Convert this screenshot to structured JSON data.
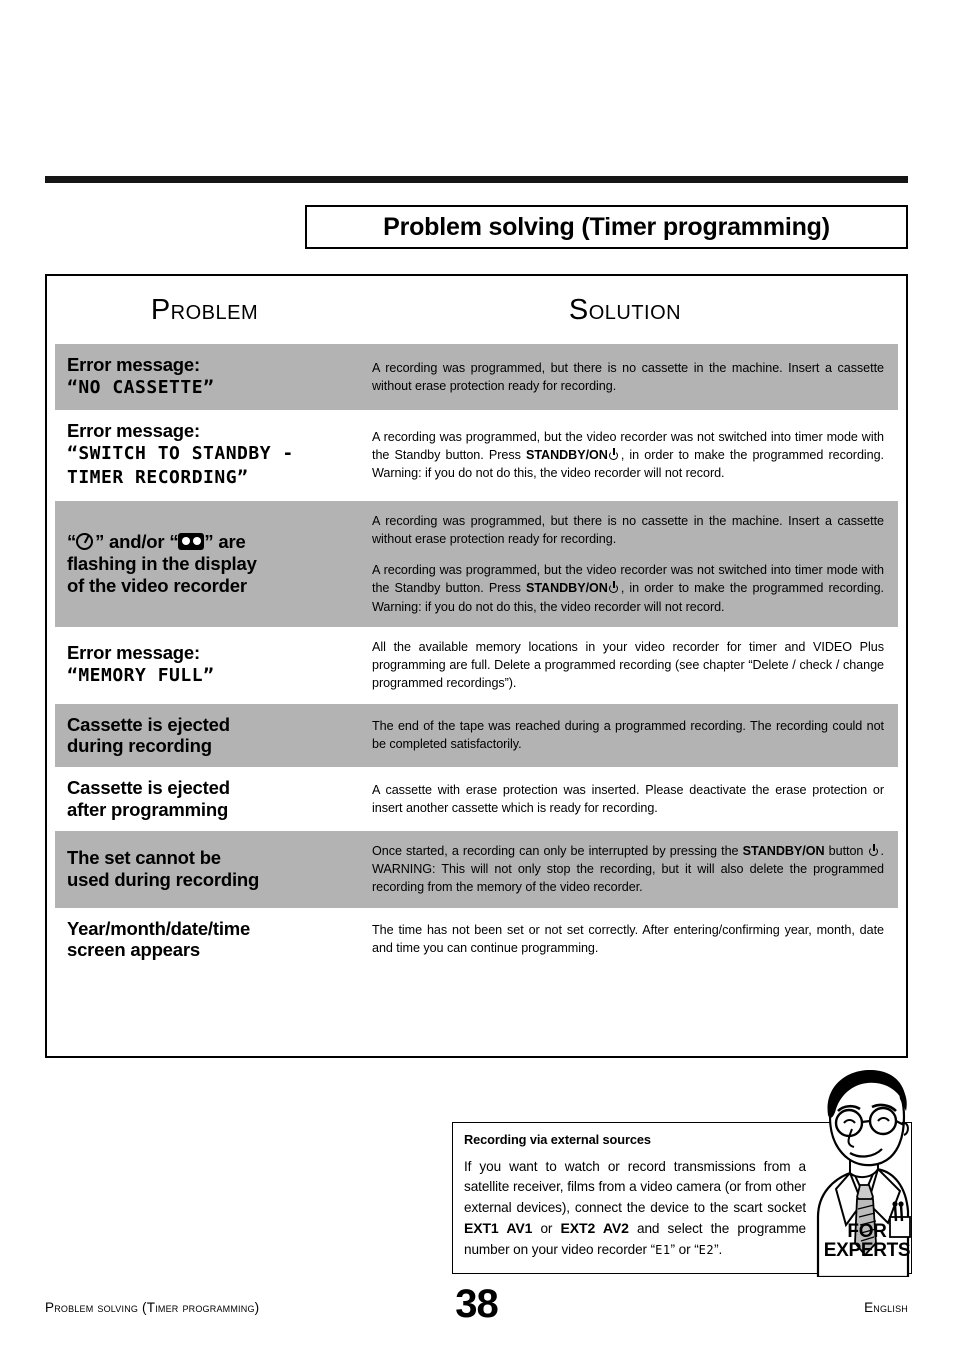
{
  "page": {
    "title": "Problem solving (Timer programming)",
    "number": "38",
    "footer_left": "Problem solving (Timer programming)",
    "footer_right": "English"
  },
  "table": {
    "header": {
      "problem": "Problem",
      "solution": "Solution"
    },
    "rows": [
      {
        "shaded": true,
        "problem_lines": [
          "Error message:"
        ],
        "problem_lcd": [
          "“NO CASSETTE”"
        ],
        "solutions": [
          "A recording was programmed, but there is no cassette in the machine. Insert a cassette without erase protection ready for recording."
        ]
      },
      {
        "shaded": false,
        "problem_lines": [
          "Error message:"
        ],
        "problem_lcd": [
          "“SWITCH TO STANDBY -",
          "TIMER RECORDING”"
        ],
        "solutions": [
          "A recording was programmed, but the video recorder was not switched into timer mode with the Standby button. Press STANDBY/ON ⏻, in order to make the programmed recording. Warning: if you do not do this, the video recorder will not record."
        ]
      },
      {
        "shaded": true,
        "problem_icons": [
          "clock-icon",
          "cassette-icon"
        ],
        "problem_lines": [
          "“ ” and/or “ ” are",
          "flashing in the display",
          "of the video recorder"
        ],
        "solutions": [
          "A recording was programmed, but there is no cassette in the machine. Insert a cassette without erase protection ready for recording.",
          "A recording was programmed, but the video recorder was not switched into timer mode with the Standby button. Press STANDBY/ON ⏻, in order to make the programmed recording. Warning: if you do not do this, the video recorder will not record."
        ]
      },
      {
        "shaded": false,
        "problem_lines": [
          "Error message:"
        ],
        "problem_lcd": [
          "“MEMORY FULL”"
        ],
        "solutions": [
          "All the available memory locations in your video recorder for timer and VIDEO Plus programming are full. Delete a programmed recording (see chapter “Delete / check / change programmed recordings”)."
        ]
      },
      {
        "shaded": true,
        "problem_lines": [
          "Cassette is ejected",
          "during recording"
        ],
        "solutions": [
          "The end of the tape was reached during a programmed recording. The recording could not be completed satisfactorily."
        ]
      },
      {
        "shaded": false,
        "problem_lines": [
          "Cassette is ejected",
          "after programming"
        ],
        "solutions": [
          "A cassette with erase protection was inserted. Please deactivate the erase protection or insert another cassette which is ready for recording."
        ]
      },
      {
        "shaded": true,
        "problem_lines": [
          "The set cannot be",
          "used during recording"
        ],
        "solutions": [
          "Once started, a recording can only be interrupted by pressing the STANDBY/ON button ⏻. WARNING: This will not only stop the recording, but it will also delete the programmed recording from the memory of the video recorder."
        ]
      },
      {
        "shaded": false,
        "problem_lines": [
          "Year/month/date/time",
          "screen appears"
        ],
        "solutions": [
          "The time has not been set or not set correctly. After entering/confirming year, month, date and time you can continue programming."
        ]
      }
    ]
  },
  "experts": {
    "title": "Recording via external sources",
    "body_parts": {
      "p1": "If you want to watch or record transmissions from a satellite receiver, films from a video camera (or from other external devices), connect the device to the scart socket ",
      "b1": "EXT1 AV1",
      "p2": " or ",
      "b2": "EXT2 AV2",
      "p3": " and select the programme number on your video recorder “",
      "lcd1": "E1",
      "p4": "” or “",
      "lcd2": "E2",
      "p5": "”."
    },
    "label_line1": "FOR",
    "label_line2": "EXPERTS"
  },
  "solution_text_cells": {
    "r1_s1_a": "A recording was programmed, but there is no cassette in the machine. Insert a cassette without erase protection ready for recording.",
    "r2_s1_a": "A recording was programmed, but the video recorder was not switched into timer mode with the Standby button. Press ",
    "r2_s1_b": "STANDBY/ON",
    "r2_s1_c": ", in order to make the programmed recording. Warning: if you do not do this, the video recorder will not record.",
    "r4_s1": "All the available memory locations in your video recorder for timer and VIDEO Plus programming are full. Delete a programmed recording (see chapter “Delete / check / change programmed recordings”).",
    "r5_s1": "The end of the tape was reached during a programmed recording. The recording could not be completed satisfactorily.",
    "r6_s1": "A cassette with erase protection was inserted. Please deactivate the erase protection or insert another cassette which is ready for recording.",
    "r7_s1_a": "Once started, a recording can only be interrupted by pressing the ",
    "r7_s1_b": "STANDBY/ON",
    "r7_s1_c": " button ",
    "r7_s1_d": ". WARNING: This will not only stop the recording, but it will also delete the programmed recording from the memory of the video recorder.",
    "r8_s1": "The time has not been set or not set correctly. After entering/confirming year, month, date and time you can continue programming."
  },
  "problem_labels": {
    "error_message": "Error message:",
    "no_cassette": "“NO CASSETTE”",
    "switch_standby_1": "“SWITCH TO STANDBY -",
    "switch_standby_2": "TIMER RECORDING”",
    "memory_full": "“MEMORY FULL”",
    "flash_a": "” and/or “",
    "flash_b": "” are",
    "flash_line2": "flashing in the display",
    "flash_line3": "of the video recorder",
    "cass_eject_dur_1": "Cassette is ejected",
    "cass_eject_dur_2": "during recording",
    "cass_eject_aft_1": "Cassette is ejected",
    "cass_eject_aft_2": "after programming",
    "set_cannot_1": "The set cannot be",
    "set_cannot_2": "used during recording",
    "ymdt_1": "Year/month/date/time",
    "ymdt_2": "screen appears",
    "quote_open": "“"
  },
  "colors": {
    "shade": "#b3b3b3",
    "ink": "#000000",
    "paper": "#ffffff"
  }
}
